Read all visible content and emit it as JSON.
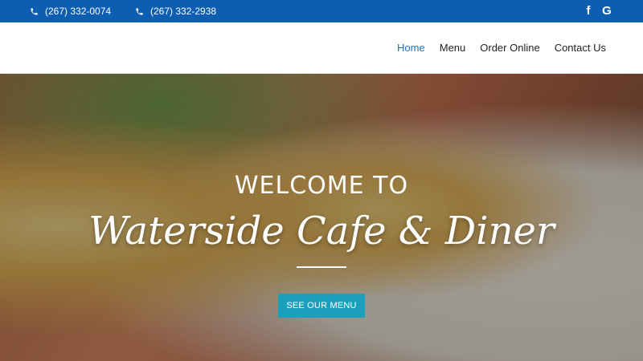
{
  "topbar": {
    "phones": [
      "(267) 332-0074",
      "(267) 332-2938"
    ],
    "social_icons": [
      "facebook-icon",
      "google-icon"
    ],
    "social_glyphs": [
      "f",
      "G"
    ],
    "background_color": "#0d5eb0"
  },
  "nav": {
    "items": [
      "Home",
      "Menu",
      "Order Online",
      "Contact Us"
    ],
    "active": "Home",
    "active_color": "#1f6fb8"
  },
  "hero": {
    "welcome": "WELCOME TO",
    "title": "Waterside Cafe & Diner",
    "cta_label": "SEE OUR MENU",
    "cta_color": "#1aa0bd"
  }
}
